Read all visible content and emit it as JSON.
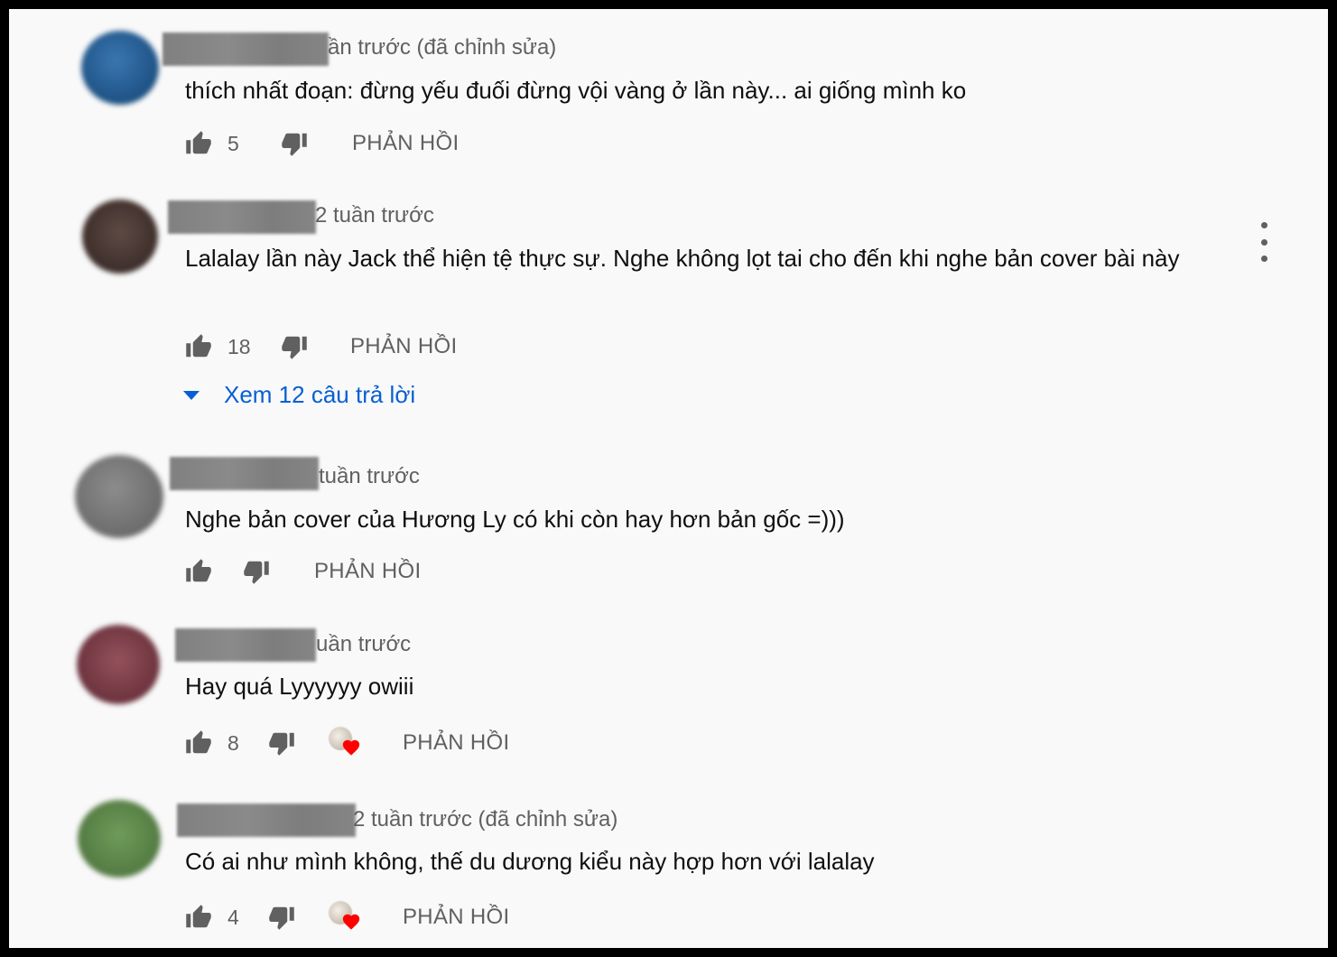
{
  "comments": [
    {
      "meta": "ần trước (đã chỉnh sửa)",
      "text": "thích nhất đoạn: đừng yếu đuối đừng vội vàng ở lần này... ai giống mình ko",
      "likes": "5",
      "reply_label": "PHẢN HỒI",
      "avatar_color": "#2a5f94",
      "creator_heart": false
    },
    {
      "meta": "2 tuần trước",
      "text": "Lalalay lần này Jack thể hiện tệ thực sự. Nghe không lọt tai cho đến khi nghe bản cover bài này",
      "likes": "18",
      "reply_label": "PHẢN HỒI",
      "avatar_color": "#4a3a36",
      "creator_heart": false,
      "view_replies_label": "Xem 12 câu trả lời"
    },
    {
      "meta": "tuần trước",
      "text": "Nghe bản cover của Hương Ly có khi còn hay hơn bản gốc =)))",
      "likes": "",
      "reply_label": "PHẢN HỒI",
      "avatar_color": "#7a7a7a",
      "creator_heart": false
    },
    {
      "meta": "uần trước",
      "text": "Hay quá Lyyyyyy owiii",
      "likes": "8",
      "reply_label": "PHẢN HỒI",
      "avatar_color": "#7a3b45",
      "creator_heart": true
    },
    {
      "meta": "2 tuần trước (đã chỉnh sửa)",
      "text": "Có ai như mình không, thế du dương kiểu này hợp hơn với lalalay",
      "likes": "4",
      "reply_label": "PHẢN HỒI",
      "avatar_color": "#5f8a4c",
      "creator_heart": true
    }
  ],
  "colors": {
    "background": "#f9f9f9",
    "secondary_text": "#606060",
    "link_blue": "#065fd4",
    "heart_red": "#ff0000"
  },
  "icons": [
    "thumb-up-icon",
    "thumb-down-icon",
    "more-vert-icon",
    "caret-down-icon",
    "heart-icon"
  ]
}
